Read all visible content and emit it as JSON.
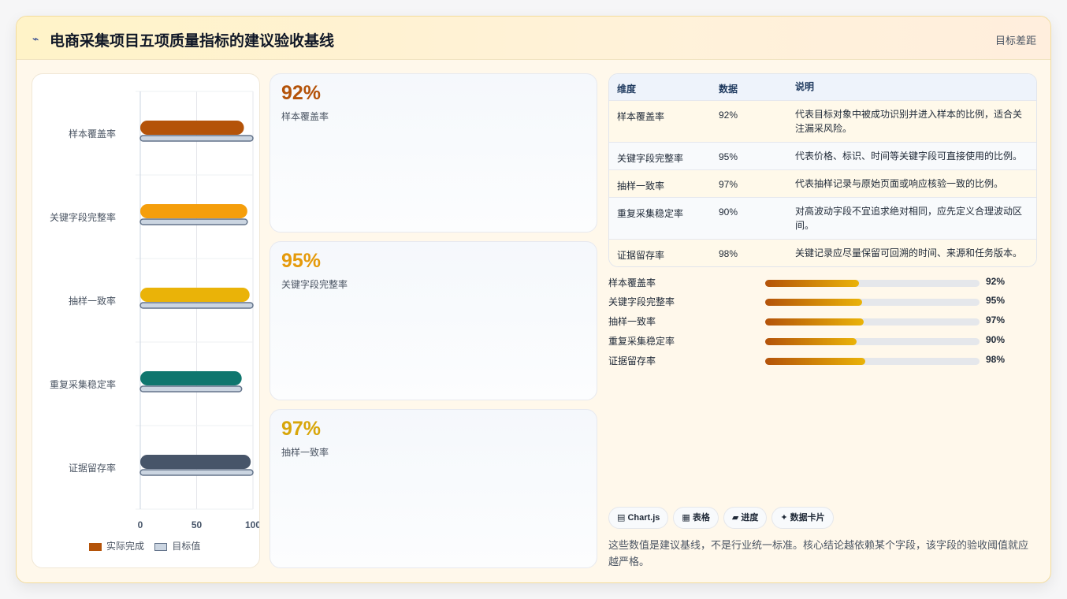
{
  "header": {
    "icon": "sparkline-icon",
    "title": "电商采集项目五项质量指标的建议验收基线",
    "right_label": "目标差距"
  },
  "chart_data": {
    "type": "bar",
    "orientation": "horizontal",
    "categories": [
      "样本覆盖率",
      "关键字段完整率",
      "抽样一致率",
      "重复采集稳定率",
      "证据留存率"
    ],
    "series": [
      {
        "name": "实际完成",
        "values": [
          92,
          95,
          97,
          90,
          98
        ],
        "colors": [
          "#b45309",
          "#f59e0b",
          "#eab308",
          "#0f766e",
          "#475569"
        ]
      },
      {
        "name": "目标值",
        "values": [
          100,
          95,
          100,
          90,
          100
        ],
        "color": "#cbd5e1"
      }
    ],
    "x_ticks": [
      "0",
      "50",
      "100"
    ],
    "xlim": [
      0,
      100
    ],
    "grid": true,
    "legend_position": "bottom"
  },
  "kpis": [
    {
      "value": "92%",
      "label": "样本覆盖率",
      "color": "#b45309"
    },
    {
      "value": "95%",
      "label": "关键字段完整率",
      "color": "#e59a0b"
    },
    {
      "value": "97%",
      "label": "抽样一致率",
      "color": "#d8a60a"
    }
  ],
  "table": {
    "headers": [
      "维度",
      "数据",
      "说明"
    ],
    "rows": [
      {
        "dim": "样本覆盖率",
        "val": "92%",
        "desc": "代表目标对象中被成功识别并进入样本的比例，适合关注漏采风险。"
      },
      {
        "dim": "关键字段完整率",
        "val": "95%",
        "desc": "代表价格、标识、时间等关键字段可直接使用的比例。"
      },
      {
        "dim": "抽样一致率",
        "val": "97%",
        "desc": "代表抽样记录与原始页面或响应核验一致的比例。"
      },
      {
        "dim": "重复采集稳定率",
        "val": "90%",
        "desc": "对高波动字段不宜追求绝对相同，应先定义合理波动区间。"
      },
      {
        "dim": "证据留存率",
        "val": "98%",
        "desc": "关键记录应尽量保留可回溯的时间、来源和任务版本。"
      }
    ]
  },
  "progress": [
    {
      "label": "样本覆盖率",
      "value": "92%",
      "fraction": 0.92
    },
    {
      "label": "关键字段完整率",
      "value": "95%",
      "fraction": 0.95
    },
    {
      "label": "抽样一致率",
      "value": "97%",
      "fraction": 0.97
    },
    {
      "label": "重复采集稳定率",
      "value": "90%",
      "fraction": 0.9
    },
    {
      "label": "证据留存率",
      "value": "98%",
      "fraction": 0.98
    }
  ],
  "chips": [
    "▤ Chart.js",
    "▦ 表格",
    "▰ 进度",
    "✦ 数据卡片"
  ],
  "note": "这些数值是建议基线，不是行业统一标准。核心结论越依赖某个字段，该字段的验收阈值就应越严格。"
}
